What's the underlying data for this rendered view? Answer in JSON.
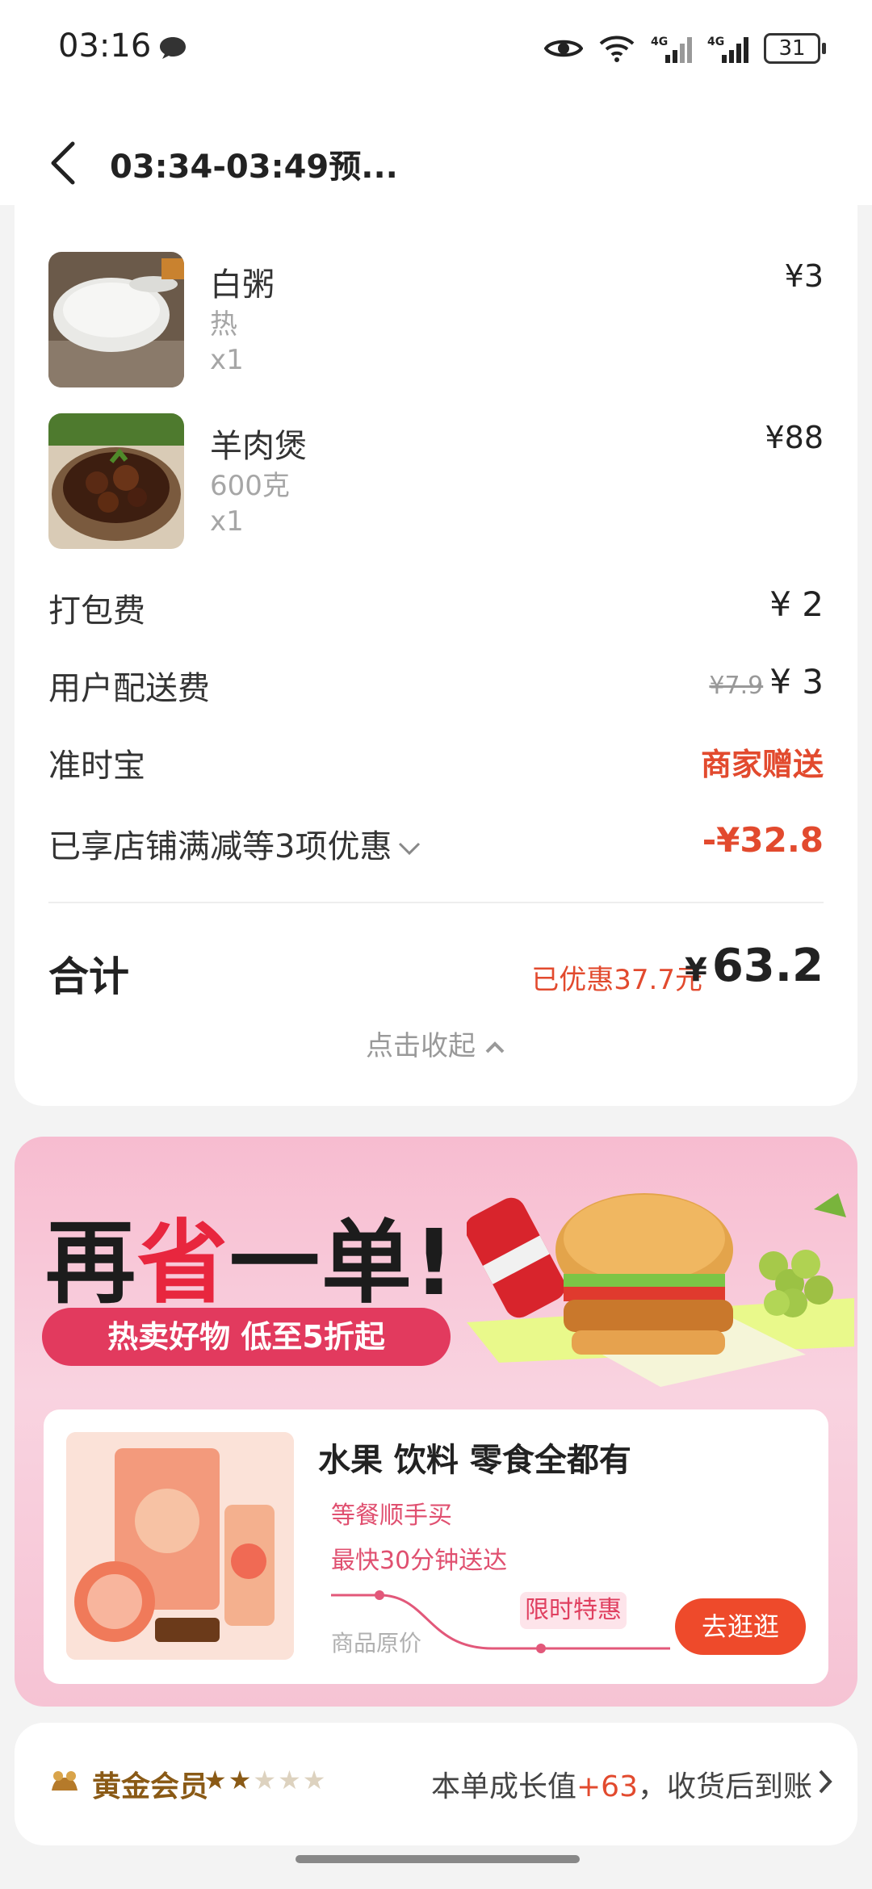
{
  "status_bar": {
    "time": "03:16",
    "battery": "31"
  },
  "header": {
    "title": "03:34-03:49预..."
  },
  "items": [
    {
      "name": "白粥",
      "spec": "热",
      "qty": "x1",
      "price": "¥3"
    },
    {
      "name": "羊肉煲",
      "spec": "600克",
      "qty": "x1",
      "price": "¥88"
    }
  ],
  "fees": {
    "packing_label": "打包费",
    "packing_value": "¥ 2",
    "delivery_label": "用户配送费",
    "delivery_original": "¥7.9",
    "delivery_value": "¥ 3",
    "ontime_label": "准时宝",
    "ontime_value": "商家赠送",
    "discount_label": "已享店铺满减等3项优惠",
    "discount_value": "-¥32.8"
  },
  "summary": {
    "total_label": "合计",
    "saved_text": "已优惠37.7元",
    "currency": "¥",
    "total_value": "63.2",
    "collapse_text": "点击收起"
  },
  "promo": {
    "headline_a": "再",
    "headline_b": "省",
    "headline_c": "一单!",
    "pill_text": "热卖好物 低至5折起",
    "card_title": "水果 饮料 零食全都有",
    "line1": "等餐顺手买",
    "line2": "最快30分钟送达",
    "original_price_label": "商品原价",
    "flash_label": "限时特惠",
    "button": "去逛逛"
  },
  "member": {
    "level": "黄金会员",
    "stars_on": 2,
    "stars_total": 5,
    "growth_prefix": "本单成长值",
    "growth_points": "+63",
    "growth_suffix": "，收货后到账",
    "colors": {
      "gold": "#8a5a16",
      "accent": "#e24a2e"
    }
  }
}
